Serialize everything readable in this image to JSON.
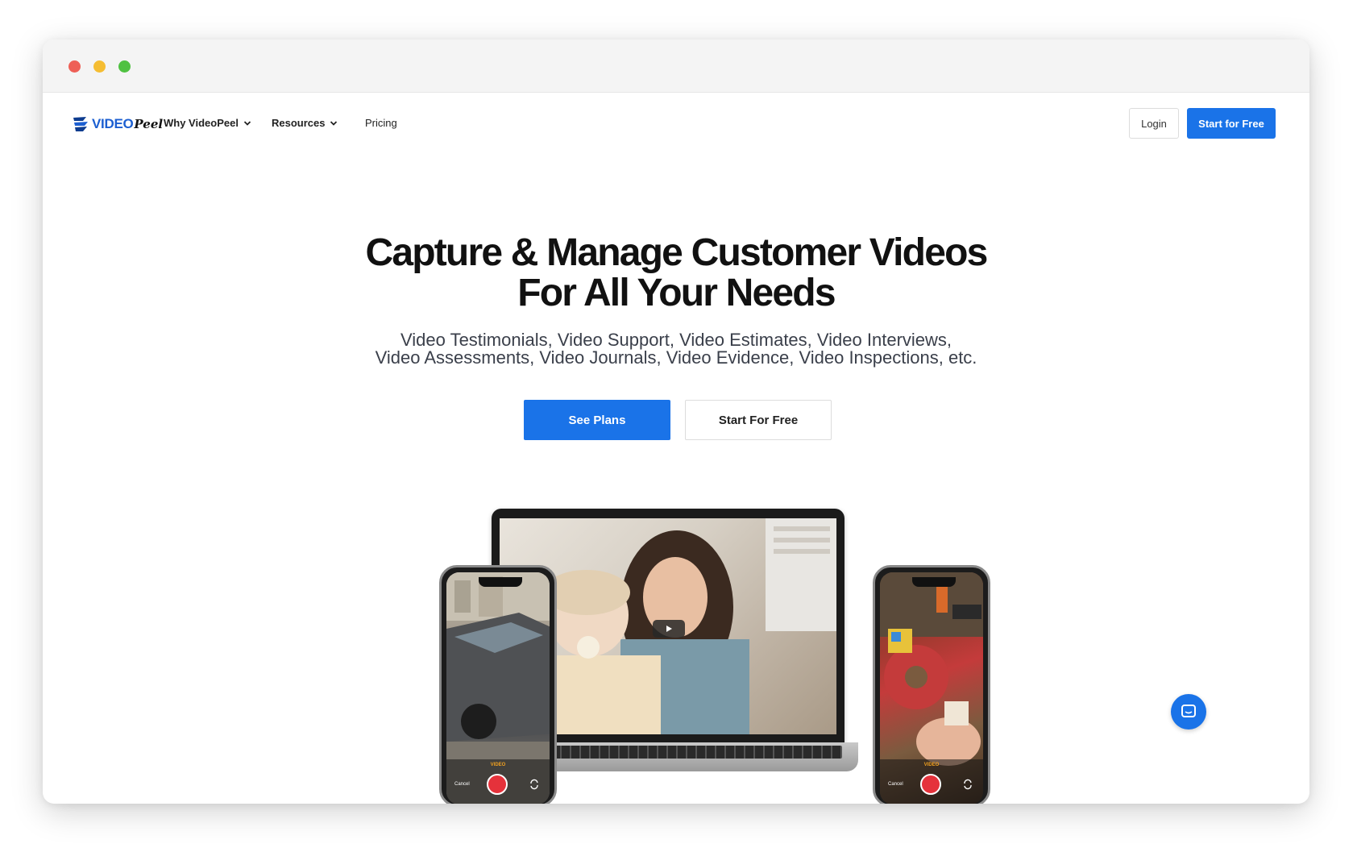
{
  "nav": {
    "logo_text": "VIDEO",
    "logo_script": "Peel",
    "items": [
      {
        "label": "Why VideoPeel",
        "has_dropdown": true
      },
      {
        "label": "Resources",
        "has_dropdown": true
      },
      {
        "label": "Pricing",
        "has_dropdown": false
      }
    ],
    "login_label": "Login",
    "start_label": "Start for Free"
  },
  "hero": {
    "title_line1": "Capture & Manage Customer Videos",
    "title_line2": "For All Your Needs",
    "subtitle_line1": "Video Testimonials, Video Support, Video Estimates, Video Interviews,",
    "subtitle_line2": "Video Assessments, Video Journals, Video Evidence, Video Inspections, etc.",
    "cta_primary": "See Plans",
    "cta_secondary": "Start For Free"
  },
  "devices": {
    "phone_left": {
      "rec_label": "VIDEO",
      "cancel_label": "Cancel"
    },
    "phone_right": {
      "rec_label": "VIDEO",
      "cancel_label": "Cancel"
    }
  },
  "colors": {
    "accent": "#1a73e8",
    "record_red": "#e5323b",
    "traffic_red": "#ee5f56",
    "traffic_yellow": "#f5bd32",
    "traffic_green": "#4fc141"
  },
  "icons": {
    "logo": "videopeel-logo-icon",
    "dropdown": "chevron-down-icon",
    "play": "play-icon",
    "record": "record-icon",
    "flip": "camera-flip-icon",
    "chat": "chat-icon"
  }
}
